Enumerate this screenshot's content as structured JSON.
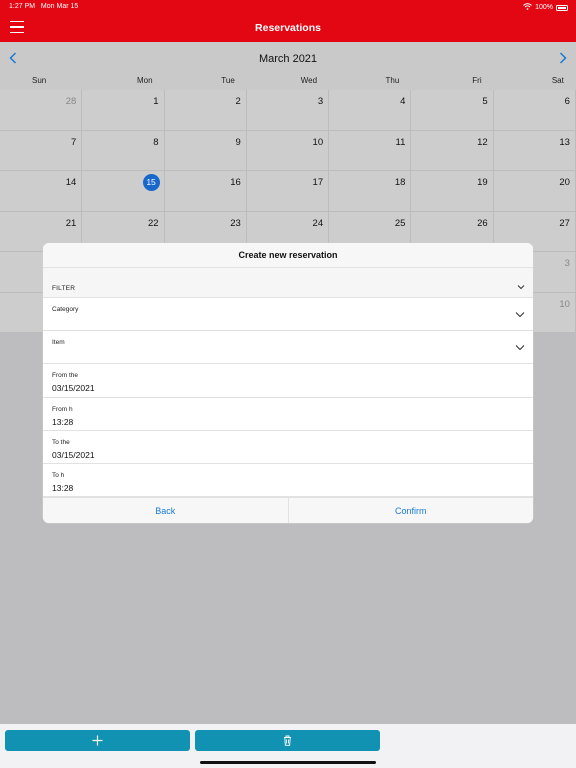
{
  "status": {
    "time": "1:27 PM",
    "date": "Mon Mar 15",
    "battery": "100%"
  },
  "header": {
    "title": "Reservations"
  },
  "calendar": {
    "month": "March 2021",
    "weekdays": [
      "Sun",
      "Mon",
      "Tue",
      "Wed",
      "Thu",
      "Fri",
      "Sat"
    ],
    "days": [
      [
        "28",
        "1",
        "2",
        "3",
        "4",
        "5",
        "6"
      ],
      [
        "7",
        "8",
        "9",
        "10",
        "11",
        "12",
        "13"
      ],
      [
        "14",
        "15",
        "16",
        "17",
        "18",
        "19",
        "20"
      ],
      [
        "21",
        "22",
        "23",
        "24",
        "25",
        "26",
        "27"
      ],
      [
        "",
        "",
        "",
        "",
        "",
        "",
        "3"
      ],
      [
        "",
        "",
        "",
        "",
        "",
        "",
        "10"
      ]
    ],
    "today": "15"
  },
  "modal": {
    "title": "Create new reservation",
    "filter_label": "FILTER",
    "fields": [
      {
        "label": "Category",
        "value": "",
        "dropdown": true
      },
      {
        "label": "Item",
        "value": "",
        "dropdown": true
      },
      {
        "label": "From the",
        "value": "03/15/2021",
        "dropdown": false
      },
      {
        "label": "From h",
        "value": "13:28",
        "dropdown": false
      },
      {
        "label": "To the",
        "value": "03/15/2021",
        "dropdown": false
      },
      {
        "label": "To h",
        "value": "13:28",
        "dropdown": false
      }
    ],
    "back_label": "Back",
    "confirm_label": "Confirm"
  },
  "colors": {
    "header": "#e30613",
    "accent": "#1868cc",
    "link": "#1a7ad4",
    "bottom_button": "#1192b3"
  },
  "bottom_bar": {
    "add_icon": "plus-icon",
    "delete_icon": "trash-icon"
  }
}
